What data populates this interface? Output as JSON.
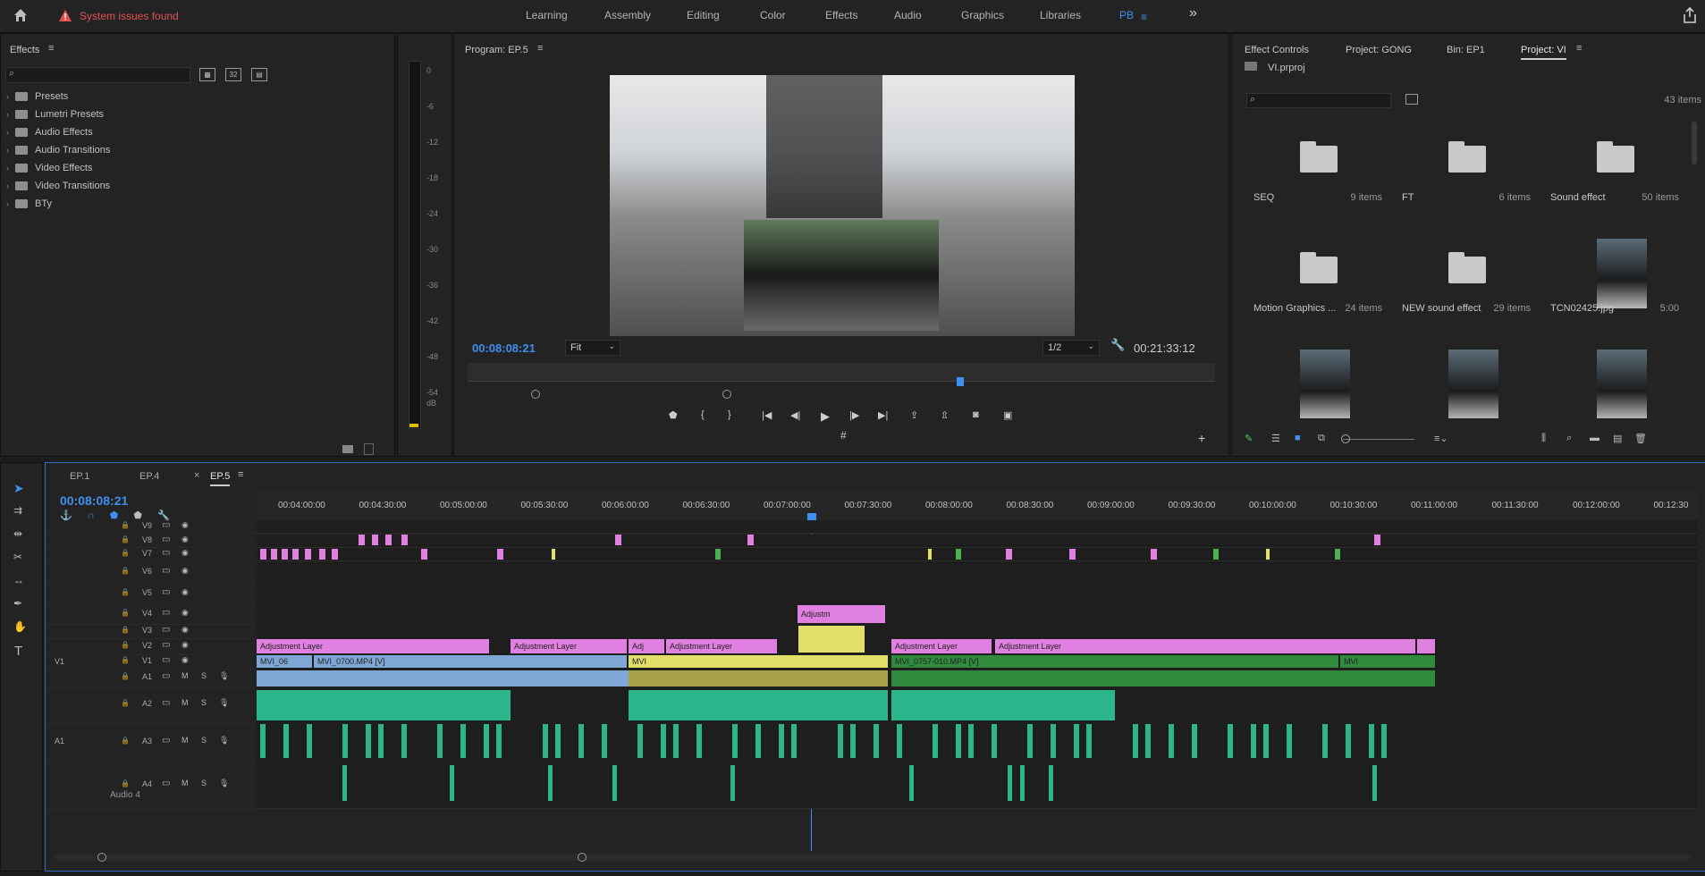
{
  "top_bar": {
    "home_icon": "home-icon",
    "warning_icon": "warning-icon",
    "warning_text": "System issues found",
    "workspaces": [
      "Learning",
      "Assembly",
      "Editing",
      "Color",
      "Effects",
      "Audio",
      "Graphics",
      "Libraries",
      "PB"
    ],
    "active_workspace": "PB",
    "more": "»",
    "share_icon": "share-icon"
  },
  "effects_panel": {
    "title": "Effects",
    "items": [
      "Presets",
      "Lumetri Presets",
      "Audio Effects",
      "Audio Transitions",
      "Video Effects",
      "Video Transitions",
      "BTy"
    ]
  },
  "audio_meter": {
    "ticks": [
      "0",
      "-6",
      "-12",
      "-18",
      "-24",
      "-30",
      "-36",
      "-42",
      "-48",
      "-54",
      "dB"
    ]
  },
  "program_monitor": {
    "title": "Program: EP.5",
    "current_time": "00:08:08:21",
    "fit": "Fit",
    "resolution": "1/2",
    "duration": "00:21:33:12"
  },
  "project_panel": {
    "tabs": [
      "Effect Controls",
      "Project: GONG",
      "Bin: EP1",
      "Project: VI"
    ],
    "active_tab": "Project: VI",
    "file_name": "VI.prproj",
    "item_count": "43 items",
    "items": [
      {
        "name": "SEQ",
        "count": "9 items",
        "type": "folder"
      },
      {
        "name": "FT",
        "count": "6 items",
        "type": "folder"
      },
      {
        "name": "Sound effect",
        "count": "50 items",
        "type": "folder"
      },
      {
        "name": "Motion Graphics ...",
        "count": "24 items",
        "type": "folder"
      },
      {
        "name": "NEW sound effect",
        "count": "29 items",
        "type": "folder"
      },
      {
        "name": "TCN02425.jpg",
        "count": "5:00",
        "type": "image"
      }
    ]
  },
  "timeline": {
    "tabs": [
      "EP.1",
      "EP.4",
      "EP.5"
    ],
    "active_tab": "EP.5",
    "current_time": "00:08:08:21",
    "ruler": [
      "00:04:00:00",
      "00:04:30:00",
      "00:05:00:00",
      "00:05:30:00",
      "00:06:00:00",
      "00:06:30:00",
      "00:07:00:00",
      "00:07:30:00",
      "00:08:00:00",
      "00:08:30:00",
      "00:09:00:00",
      "00:09:30:00",
      "00:10:00:00",
      "00:10:30:00",
      "00:11:00:00",
      "00:11:30:00",
      "00:12:00:00",
      "00:12:30"
    ],
    "video_tracks": [
      "V9",
      "V8",
      "V7",
      "V6",
      "V5",
      "V4",
      "V3",
      "V2",
      "V1"
    ],
    "audio_tracks": [
      "A1",
      "A2",
      "A3",
      "A4"
    ],
    "source_v": "V1",
    "source_a": "A1",
    "a4_name": "Audio 4",
    "clip_labels": {
      "adj1": "Adjustment Layer",
      "adj2": "Adjustment Layer",
      "adj3": "Adj",
      "adj4": "Adjustment Layer",
      "adj5": "Adjustment Layer",
      "adj6": "Adjustment Layer",
      "adjm": "Adjustm",
      "mvi06": "MVI_06",
      "mvi0700": "MVI_0700.MP4 [V]",
      "mvi": "MVI",
      "mvi0757": "MVI_0757-010.MP4 [V]",
      "mvi2": "MVI"
    }
  },
  "colors": {
    "accent": "#3f8ff0",
    "warning": "#e05252",
    "adjustment": "#e080e0",
    "video_blue": "#7ea7d6",
    "video_yellow": "#e3e06a",
    "video_green": "#2f8a3e",
    "audio_green": "#2bb58a"
  }
}
